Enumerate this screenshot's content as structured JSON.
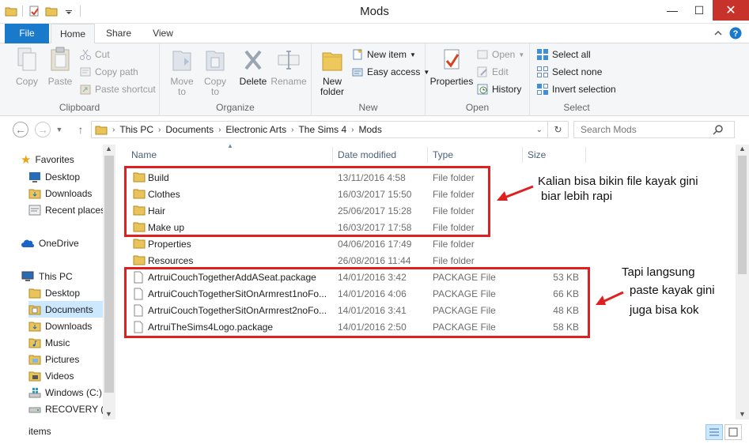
{
  "window": {
    "title": "Mods",
    "minimize": "—",
    "maximize": "☐",
    "close": "✕"
  },
  "tabs": {
    "file": "File",
    "home": "Home",
    "share": "Share",
    "view": "View"
  },
  "ribbon": {
    "clipboard": {
      "label": "Clipboard",
      "copy": "Copy",
      "paste": "Paste",
      "cut": "Cut",
      "copy_path": "Copy path",
      "paste_shortcut": "Paste shortcut"
    },
    "organize": {
      "label": "Organize",
      "move_to": "Move to",
      "copy_to": "Copy to",
      "delete": "Delete",
      "rename": "Rename"
    },
    "new": {
      "label": "New",
      "new_folder": "New folder",
      "new_item": "New item",
      "easy_access": "Easy access"
    },
    "open": {
      "label": "Open",
      "properties": "Properties",
      "open": "Open",
      "edit": "Edit",
      "history": "History"
    },
    "select": {
      "label": "Select",
      "select_all": "Select all",
      "select_none": "Select none",
      "invert_selection": "Invert selection"
    }
  },
  "address": {
    "crumbs": [
      "This PC",
      "Documents",
      "Electronic Arts",
      "The Sims 4",
      "Mods"
    ],
    "search_placeholder": "Search Mods"
  },
  "nav": {
    "favorites": "Favorites",
    "fav_items": [
      "Desktop",
      "Downloads",
      "Recent places"
    ],
    "onedrive": "OneDrive",
    "this_pc": "This PC",
    "pc_items": [
      "Desktop",
      "Documents",
      "Downloads",
      "Music",
      "Pictures",
      "Videos",
      "Windows (C:)",
      "RECOVERY (D"
    ]
  },
  "columns": {
    "name": "Name",
    "date": "Date modified",
    "type": "Type",
    "size": "Size"
  },
  "files": [
    {
      "name": "Build",
      "date": "13/11/2016 4:58",
      "type": "File folder",
      "size": "",
      "kind": "folder"
    },
    {
      "name": "Clothes",
      "date": "16/03/2017 15:50",
      "type": "File folder",
      "size": "",
      "kind": "folder"
    },
    {
      "name": "Hair",
      "date": "25/06/2017 15:28",
      "type": "File folder",
      "size": "",
      "kind": "folder"
    },
    {
      "name": "Make up",
      "date": "16/03/2017 17:58",
      "type": "File folder",
      "size": "",
      "kind": "folder"
    },
    {
      "name": "Properties",
      "date": "04/06/2016 17:49",
      "type": "File folder",
      "size": "",
      "kind": "folder"
    },
    {
      "name": "Resources",
      "date": "26/08/2016 11:44",
      "type": "File folder",
      "size": "",
      "kind": "folder"
    },
    {
      "name": "ArtruiCouchTogetherAddASeat.package",
      "date": "14/01/2016 3:42",
      "type": "PACKAGE File",
      "size": "53 KB",
      "kind": "file"
    },
    {
      "name": "ArtruiCouchTogetherSitOnArmrest1noFo...",
      "date": "14/01/2016 4:06",
      "type": "PACKAGE File",
      "size": "66 KB",
      "kind": "file"
    },
    {
      "name": "ArtruiCouchTogetherSitOnArmrest2noFo...",
      "date": "14/01/2016 3:41",
      "type": "PACKAGE File",
      "size": "48 KB",
      "kind": "file"
    },
    {
      "name": "ArtruiTheSims4Logo.package",
      "date": "14/01/2016 2:50",
      "type": "PACKAGE File",
      "size": "58 KB",
      "kind": "file"
    }
  ],
  "annotations": {
    "note1_line1": "Kalian bisa bikin file kayak gini",
    "note1_line2": "biar lebih rapi",
    "note2_line1": "Tapi langsung",
    "note2_line2": "paste kayak gini",
    "note2_line3": "juga bisa kok",
    "highlight_color": "#e02020"
  },
  "status": {
    "items": "items"
  }
}
